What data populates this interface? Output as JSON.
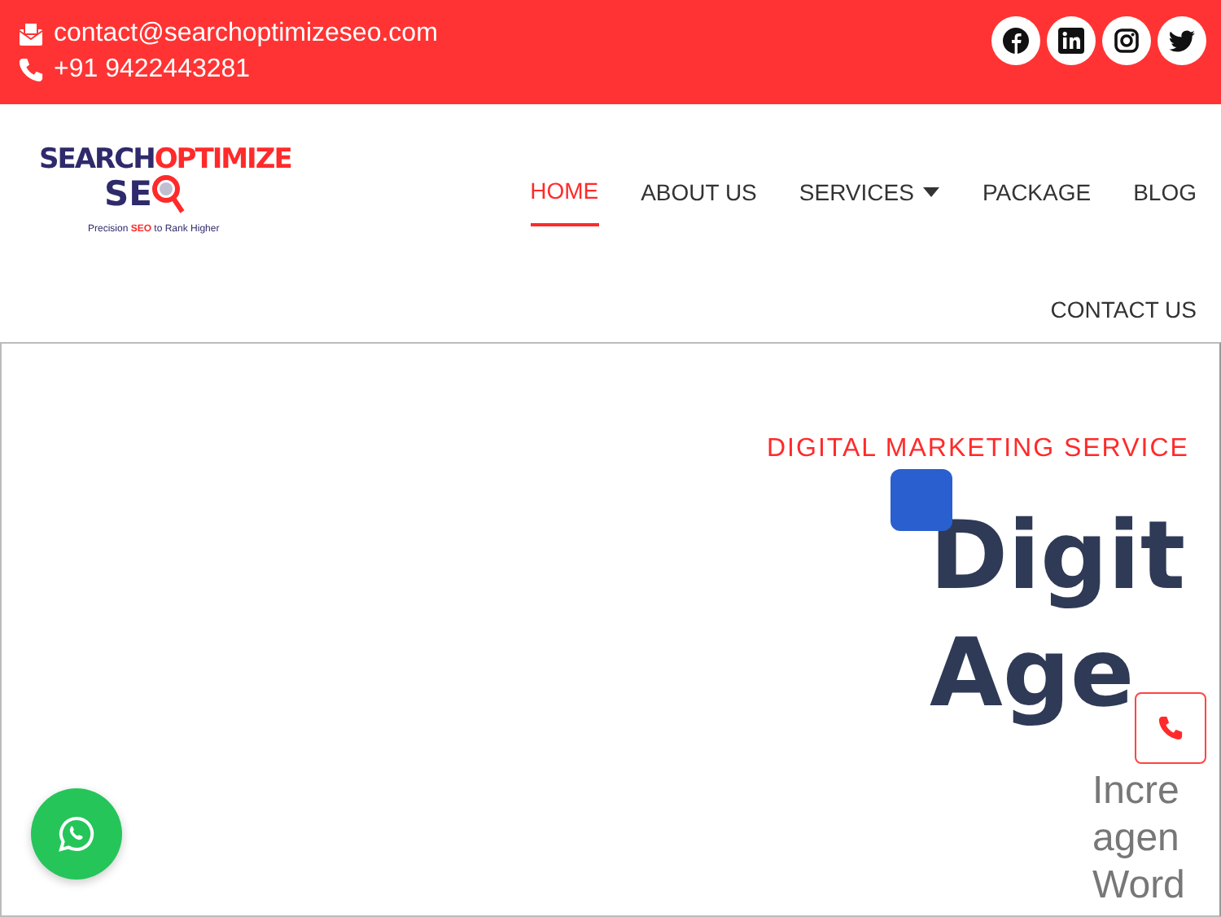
{
  "top_bar": {
    "email": "contact@searchoptimizeseo.com",
    "phone": "+91 9422443281"
  },
  "logo": {
    "word_1": "SEARCH",
    "word_2": "OPTIMIZE",
    "word_3": "SE",
    "tagline": "Precision **SEO** to Rank Higher"
  },
  "nav": [
    {
      "label": "HOME",
      "selected": true,
      "dropdown": false
    },
    {
      "label": "ABOUT US",
      "selected": false,
      "dropdown": false
    },
    {
      "label": "SERVICES",
      "selected": false,
      "dropdown": true
    },
    {
      "label": "PACKAGE",
      "selected": false,
      "dropdown": false
    },
    {
      "label": "BLOG",
      "selected": false,
      "dropdown": false
    },
    {
      "label": "CONTACT US",
      "selected": false,
      "dropdown": false
    }
  ],
  "hero": {
    "eyebrow": "DIGITAL MARKETING SERVICE",
    "heading_lines": [
      "Digit",
      "Age"
    ],
    "text_lines": [
      "Incre",
      "agen",
      "Word"
    ]
  }
}
